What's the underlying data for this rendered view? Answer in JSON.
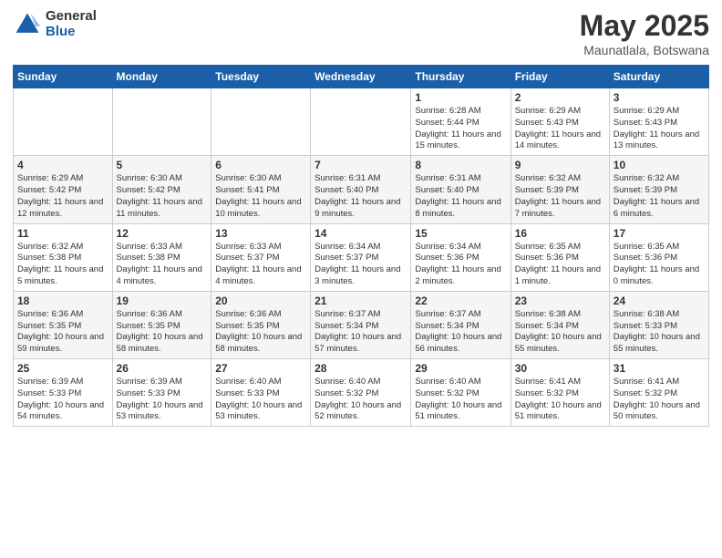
{
  "header": {
    "logo_general": "General",
    "logo_blue": "Blue",
    "title": "May 2025",
    "subtitle": "Maunatlala, Botswana"
  },
  "weekdays": [
    "Sunday",
    "Monday",
    "Tuesday",
    "Wednesday",
    "Thursday",
    "Friday",
    "Saturday"
  ],
  "weeks": [
    [
      {
        "day": "",
        "detail": ""
      },
      {
        "day": "",
        "detail": ""
      },
      {
        "day": "",
        "detail": ""
      },
      {
        "day": "",
        "detail": ""
      },
      {
        "day": "1",
        "detail": "Sunrise: 6:28 AM\nSunset: 5:44 PM\nDaylight: 11 hours\nand 15 minutes."
      },
      {
        "day": "2",
        "detail": "Sunrise: 6:29 AM\nSunset: 5:43 PM\nDaylight: 11 hours\nand 14 minutes."
      },
      {
        "day": "3",
        "detail": "Sunrise: 6:29 AM\nSunset: 5:43 PM\nDaylight: 11 hours\nand 13 minutes."
      }
    ],
    [
      {
        "day": "4",
        "detail": "Sunrise: 6:29 AM\nSunset: 5:42 PM\nDaylight: 11 hours\nand 12 minutes."
      },
      {
        "day": "5",
        "detail": "Sunrise: 6:30 AM\nSunset: 5:42 PM\nDaylight: 11 hours\nand 11 minutes."
      },
      {
        "day": "6",
        "detail": "Sunrise: 6:30 AM\nSunset: 5:41 PM\nDaylight: 11 hours\nand 10 minutes."
      },
      {
        "day": "7",
        "detail": "Sunrise: 6:31 AM\nSunset: 5:40 PM\nDaylight: 11 hours\nand 9 minutes."
      },
      {
        "day": "8",
        "detail": "Sunrise: 6:31 AM\nSunset: 5:40 PM\nDaylight: 11 hours\nand 8 minutes."
      },
      {
        "day": "9",
        "detail": "Sunrise: 6:32 AM\nSunset: 5:39 PM\nDaylight: 11 hours\nand 7 minutes."
      },
      {
        "day": "10",
        "detail": "Sunrise: 6:32 AM\nSunset: 5:39 PM\nDaylight: 11 hours\nand 6 minutes."
      }
    ],
    [
      {
        "day": "11",
        "detail": "Sunrise: 6:32 AM\nSunset: 5:38 PM\nDaylight: 11 hours\nand 5 minutes."
      },
      {
        "day": "12",
        "detail": "Sunrise: 6:33 AM\nSunset: 5:38 PM\nDaylight: 11 hours\nand 4 minutes."
      },
      {
        "day": "13",
        "detail": "Sunrise: 6:33 AM\nSunset: 5:37 PM\nDaylight: 11 hours\nand 4 minutes."
      },
      {
        "day": "14",
        "detail": "Sunrise: 6:34 AM\nSunset: 5:37 PM\nDaylight: 11 hours\nand 3 minutes."
      },
      {
        "day": "15",
        "detail": "Sunrise: 6:34 AM\nSunset: 5:36 PM\nDaylight: 11 hours\nand 2 minutes."
      },
      {
        "day": "16",
        "detail": "Sunrise: 6:35 AM\nSunset: 5:36 PM\nDaylight: 11 hours\nand 1 minute."
      },
      {
        "day": "17",
        "detail": "Sunrise: 6:35 AM\nSunset: 5:36 PM\nDaylight: 11 hours\nand 0 minutes."
      }
    ],
    [
      {
        "day": "18",
        "detail": "Sunrise: 6:36 AM\nSunset: 5:35 PM\nDaylight: 10 hours\nand 59 minutes."
      },
      {
        "day": "19",
        "detail": "Sunrise: 6:36 AM\nSunset: 5:35 PM\nDaylight: 10 hours\nand 58 minutes."
      },
      {
        "day": "20",
        "detail": "Sunrise: 6:36 AM\nSunset: 5:35 PM\nDaylight: 10 hours\nand 58 minutes."
      },
      {
        "day": "21",
        "detail": "Sunrise: 6:37 AM\nSunset: 5:34 PM\nDaylight: 10 hours\nand 57 minutes."
      },
      {
        "day": "22",
        "detail": "Sunrise: 6:37 AM\nSunset: 5:34 PM\nDaylight: 10 hours\nand 56 minutes."
      },
      {
        "day": "23",
        "detail": "Sunrise: 6:38 AM\nSunset: 5:34 PM\nDaylight: 10 hours\nand 55 minutes."
      },
      {
        "day": "24",
        "detail": "Sunrise: 6:38 AM\nSunset: 5:33 PM\nDaylight: 10 hours\nand 55 minutes."
      }
    ],
    [
      {
        "day": "25",
        "detail": "Sunrise: 6:39 AM\nSunset: 5:33 PM\nDaylight: 10 hours\nand 54 minutes."
      },
      {
        "day": "26",
        "detail": "Sunrise: 6:39 AM\nSunset: 5:33 PM\nDaylight: 10 hours\nand 53 minutes."
      },
      {
        "day": "27",
        "detail": "Sunrise: 6:40 AM\nSunset: 5:33 PM\nDaylight: 10 hours\nand 53 minutes."
      },
      {
        "day": "28",
        "detail": "Sunrise: 6:40 AM\nSunset: 5:32 PM\nDaylight: 10 hours\nand 52 minutes."
      },
      {
        "day": "29",
        "detail": "Sunrise: 6:40 AM\nSunset: 5:32 PM\nDaylight: 10 hours\nand 51 minutes."
      },
      {
        "day": "30",
        "detail": "Sunrise: 6:41 AM\nSunset: 5:32 PM\nDaylight: 10 hours\nand 51 minutes."
      },
      {
        "day": "31",
        "detail": "Sunrise: 6:41 AM\nSunset: 5:32 PM\nDaylight: 10 hours\nand 50 minutes."
      }
    ]
  ]
}
